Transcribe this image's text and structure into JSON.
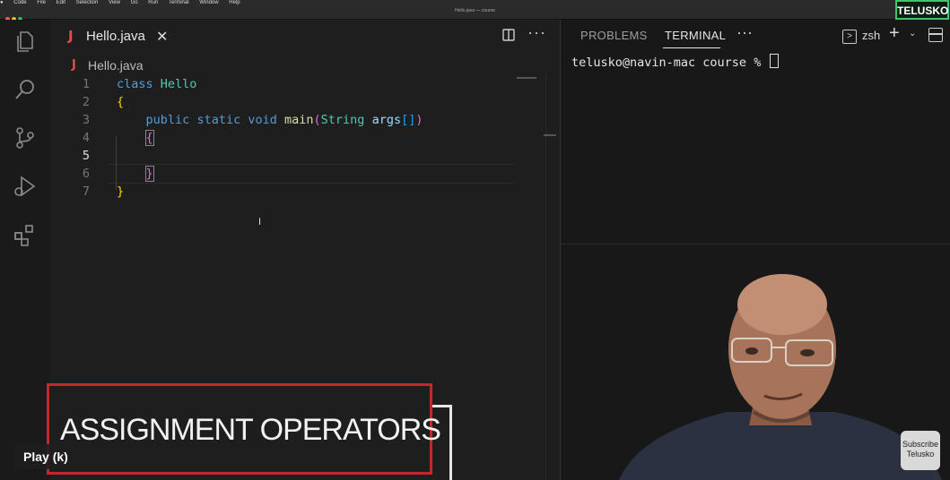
{
  "menubar": {
    "items": [
      "Code",
      "File",
      "Edit",
      "Selection",
      "View",
      "Go",
      "Run",
      "Terminal",
      "Window",
      "Help"
    ]
  },
  "window": {
    "title": "Hello.java — course"
  },
  "activity_bar": {
    "icons": [
      "explorer-icon",
      "search-icon",
      "source-control-icon",
      "run-debug-icon",
      "extensions-icon"
    ]
  },
  "editor": {
    "tab": {
      "icon_label": "J",
      "label": "Hello.java",
      "close": "✕"
    },
    "actions": {
      "split": "split-editor-icon",
      "more": "···"
    },
    "breadcrumb": {
      "icon_label": "J",
      "label": "Hello.java"
    },
    "lines": [
      {
        "num": "1",
        "parts": [
          [
            "kw",
            "class"
          ],
          [
            "txt",
            " "
          ],
          [
            "cls",
            "Hello"
          ]
        ]
      },
      {
        "num": "2",
        "parts": [
          [
            "br1",
            "{"
          ]
        ]
      },
      {
        "num": "3",
        "parts": [
          [
            "txt",
            "    "
          ],
          [
            "kw",
            "public"
          ],
          [
            "txt",
            " "
          ],
          [
            "kw",
            "static"
          ],
          [
            "txt",
            " "
          ],
          [
            "kw",
            "void"
          ],
          [
            "txt",
            " "
          ],
          [
            "fn",
            "main"
          ],
          [
            "br2",
            "("
          ],
          [
            "cls",
            "String"
          ],
          [
            "txt",
            " "
          ],
          [
            "pm",
            "args"
          ],
          [
            "br3",
            "[]"
          ],
          [
            "br2",
            ")"
          ]
        ]
      },
      {
        "num": "4",
        "parts": [
          [
            "txt",
            "    "
          ],
          [
            "br2box",
            "{"
          ]
        ]
      },
      {
        "num": "5",
        "parts": []
      },
      {
        "num": "6",
        "parts": [
          [
            "txt",
            "    "
          ],
          [
            "br2box",
            "}"
          ]
        ]
      },
      {
        "num": "7",
        "parts": [
          [
            "br1",
            "}"
          ]
        ]
      }
    ],
    "active_line": "5",
    "text_cursor": "I"
  },
  "panel": {
    "tabs": {
      "problems": "PROBLEMS",
      "terminal": "TERMINAL",
      "more": "···"
    },
    "shell_label": "zsh",
    "shell_icon": ">",
    "add": "+",
    "chevron": "⌄",
    "prompt": "telusko@navin-mac course % "
  },
  "overlay": {
    "channel_badge": "TELUSKO",
    "lower_third": "ASSIGNMENT OPERATORS",
    "play_tooltip": "Play (k)",
    "subscribe_line1": "Subscribe",
    "subscribe_line2": "Telusko"
  },
  "colors": {
    "editor_bg": "#1e1e1e",
    "panel_bg": "#181818",
    "keyword": "#569cd6",
    "class_name": "#4ec9b0",
    "function": "#dcdcaa",
    "param": "#9cdcfe",
    "badge_border": "#3fc56b",
    "lower_third_border": "#c62828"
  }
}
